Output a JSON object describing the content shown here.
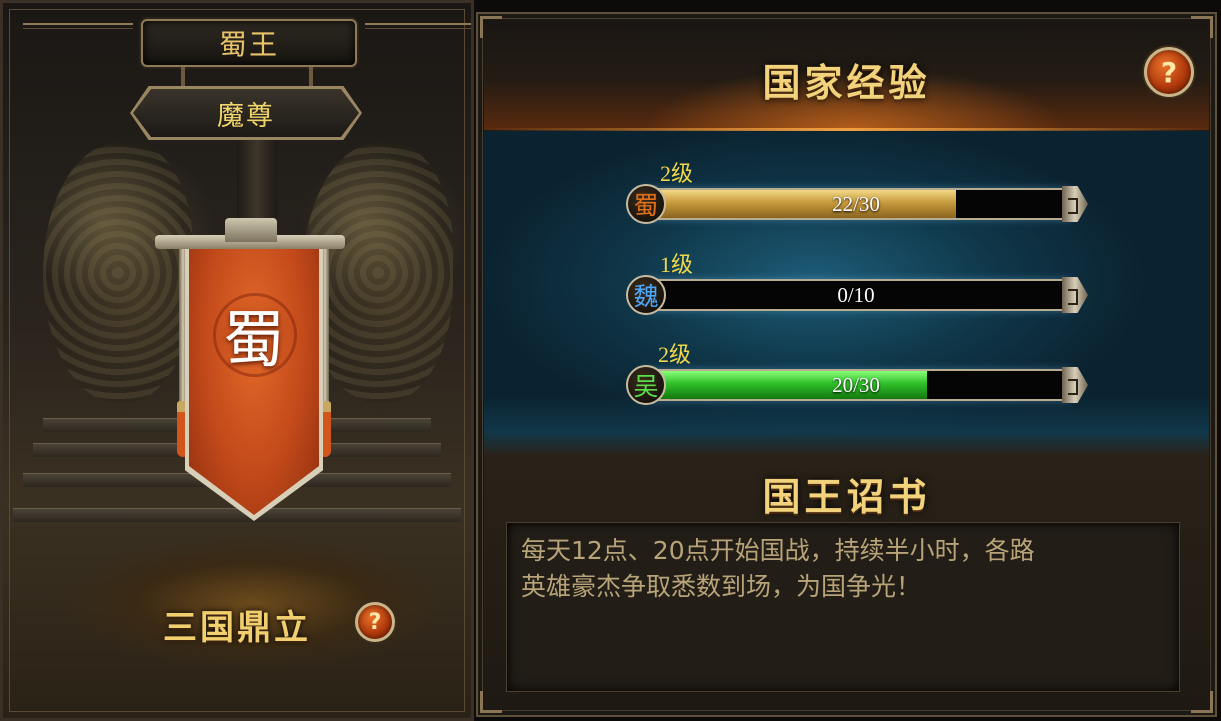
{
  "left_panel": {
    "king_title": "蜀王",
    "rank_title": "魔尊",
    "banner_character": "蜀",
    "footer_title": "三国鼎立",
    "help_label": "?"
  },
  "right_panel": {
    "exp_title": "国家经验",
    "help_label": "?",
    "kingdoms": [
      {
        "name": "蜀",
        "level": "2级",
        "progress_text": "22/30",
        "current": 22,
        "max": 30,
        "fill_color": "#c99c3e"
      },
      {
        "name": "魏",
        "level": "1级",
        "progress_text": "0/10",
        "current": 0,
        "max": 10,
        "fill_color": "#4aa8ff"
      },
      {
        "name": "吴",
        "level": "2级",
        "progress_text": "20/30",
        "current": 20,
        "max": 30,
        "fill_color": "#2fbf2a"
      }
    ],
    "decree_title": "国王诏书",
    "decree_lines": [
      "每天12点、20点开始国战，持续半小时，各路",
      "英雄豪杰争取悉数到场，为国争光！"
    ]
  },
  "colors": {
    "gold_text": "#f2d27a",
    "shu": "#e0701c",
    "wei": "#4aa8ff",
    "wu": "#5ae04a"
  }
}
